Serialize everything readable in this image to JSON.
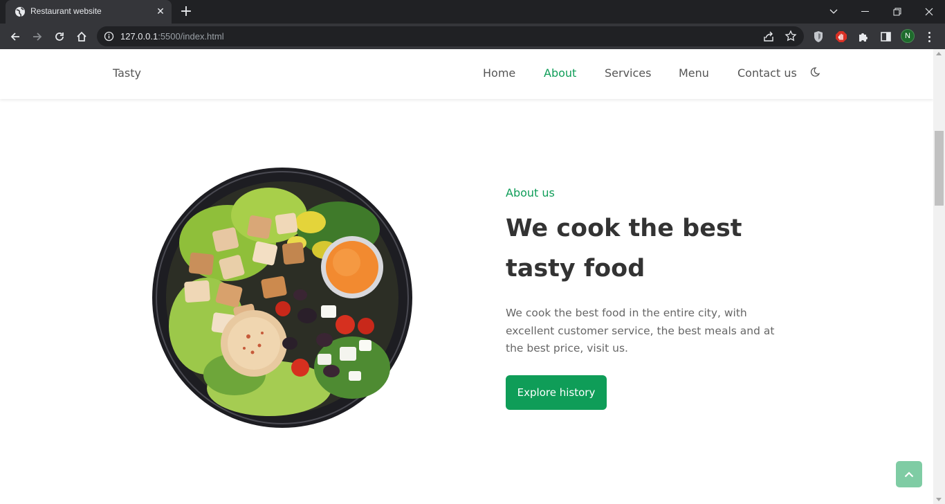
{
  "browser": {
    "tab": {
      "title": "Restaurant website"
    },
    "address": {
      "host": "127.0.0.1",
      "path": ":5500/index.html"
    },
    "profile_initial": "N"
  },
  "header": {
    "logo": "Tasty",
    "nav": [
      {
        "label": "Home"
      },
      {
        "label": "About"
      },
      {
        "label": "Services"
      },
      {
        "label": "Menu"
      },
      {
        "label": "Contact us"
      }
    ],
    "active_nav": "About"
  },
  "about": {
    "subtitle": "About us",
    "title": "We cook the best tasty food",
    "description": "We cook the best food in the entire city, with excellent customer service, the best meals and at the best price, visit us.",
    "button": "Explore history"
  },
  "colors": {
    "accent": "#0f9d58",
    "scrollup": "#7fcca4",
    "heading": "#333333",
    "text": "#666666"
  },
  "icons": {
    "theme_toggle": "moon-icon",
    "scrollup": "chevron-up-icon"
  }
}
